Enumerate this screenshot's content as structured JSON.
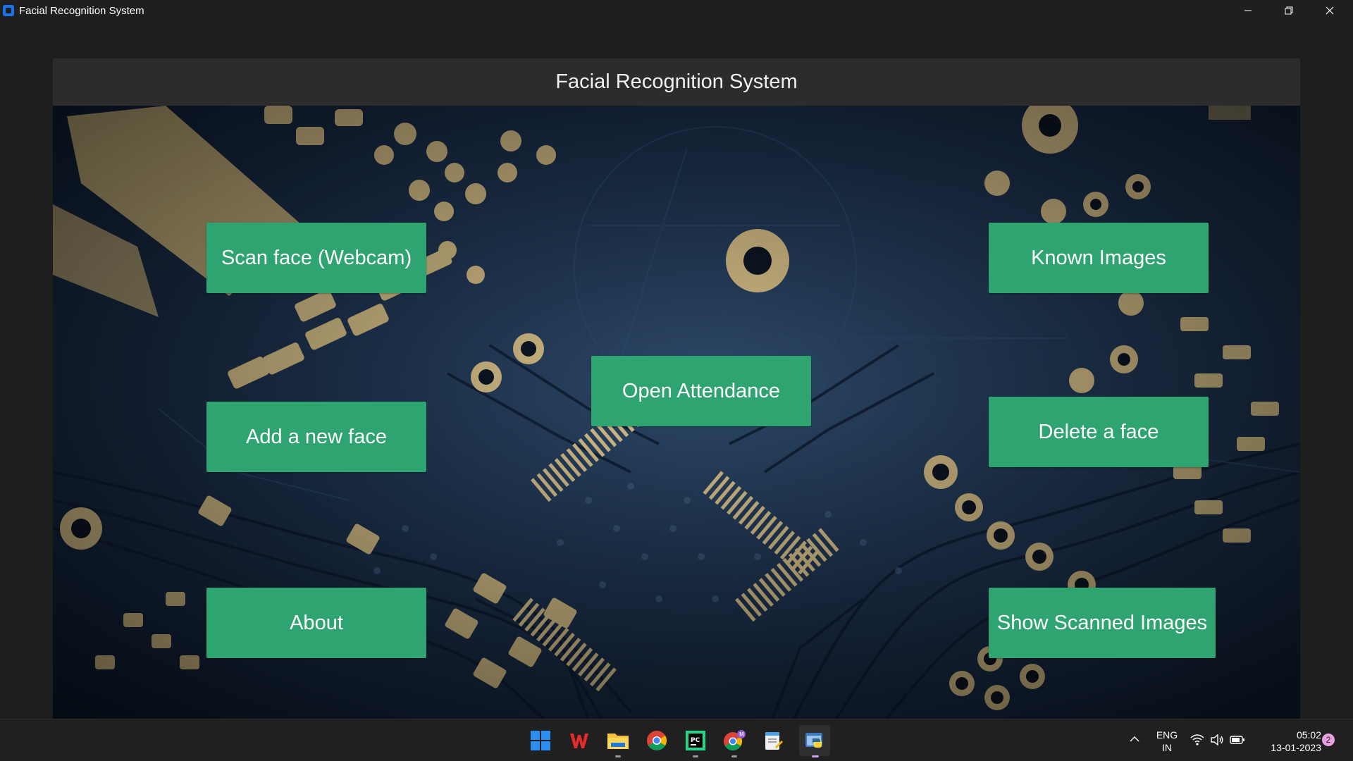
{
  "window": {
    "title": "Facial Recognition System",
    "minimize_icon": "minimize-icon",
    "restore_icon": "restore-icon",
    "close_icon": "close-icon"
  },
  "app": {
    "header_title": "Facial Recognition System",
    "background": "circuit-board-image",
    "button_color": "#2ea470",
    "buttons": {
      "scan_face": "Scan face (Webcam)",
      "known_images": "Known Images",
      "open_attendance": "Open Attendance",
      "add_face": "Add a new face",
      "delete_face": "Delete a face",
      "about": "About",
      "show_scanned": "Show Scanned Images"
    }
  },
  "taskbar": {
    "apps": [
      "windows-start-icon",
      "wps-office-icon",
      "file-explorer-icon",
      "chrome-icon",
      "pycharm-icon",
      "chrome-profile-icon",
      "notepad-icon",
      "python-app-icon"
    ],
    "language_line1": "ENG",
    "language_line2": "IN",
    "time": "05:02",
    "date": "13-01-2023",
    "notification_count": "2"
  }
}
